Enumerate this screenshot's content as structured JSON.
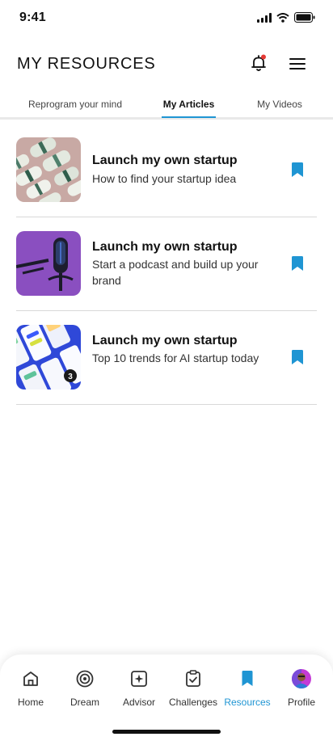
{
  "status": {
    "time": "9:41"
  },
  "header": {
    "title": "MY RESOURCES"
  },
  "tabs": [
    {
      "label": "Reprogram your mind"
    },
    {
      "label": "My Articles",
      "active": true
    },
    {
      "label": "My Videos"
    }
  ],
  "articles": [
    {
      "title": "Launch my own startup",
      "subtitle": "How to find your startup idea",
      "thumbnail": "money-rolls-image"
    },
    {
      "title": "Launch my own startup",
      "subtitle": "Start a podcast and build up your brand",
      "thumbnail": "microphone-image"
    },
    {
      "title": "Launch my own startup",
      "subtitle": "Top 10 trends for AI startup today",
      "thumbnail": "phone-screens-image"
    }
  ],
  "nav": [
    {
      "label": "Home",
      "icon": "home-icon"
    },
    {
      "label": "Dream",
      "icon": "target-icon"
    },
    {
      "label": "Advisor",
      "icon": "sparkle-icon"
    },
    {
      "label": "Challenges",
      "icon": "clipboard-check-icon"
    },
    {
      "label": "Resources",
      "icon": "bookmark-icon",
      "active": true
    },
    {
      "label": "Profile",
      "icon": "avatar"
    }
  ],
  "colors": {
    "accent": "#1f95d3",
    "notification_dot": "#e53935"
  }
}
